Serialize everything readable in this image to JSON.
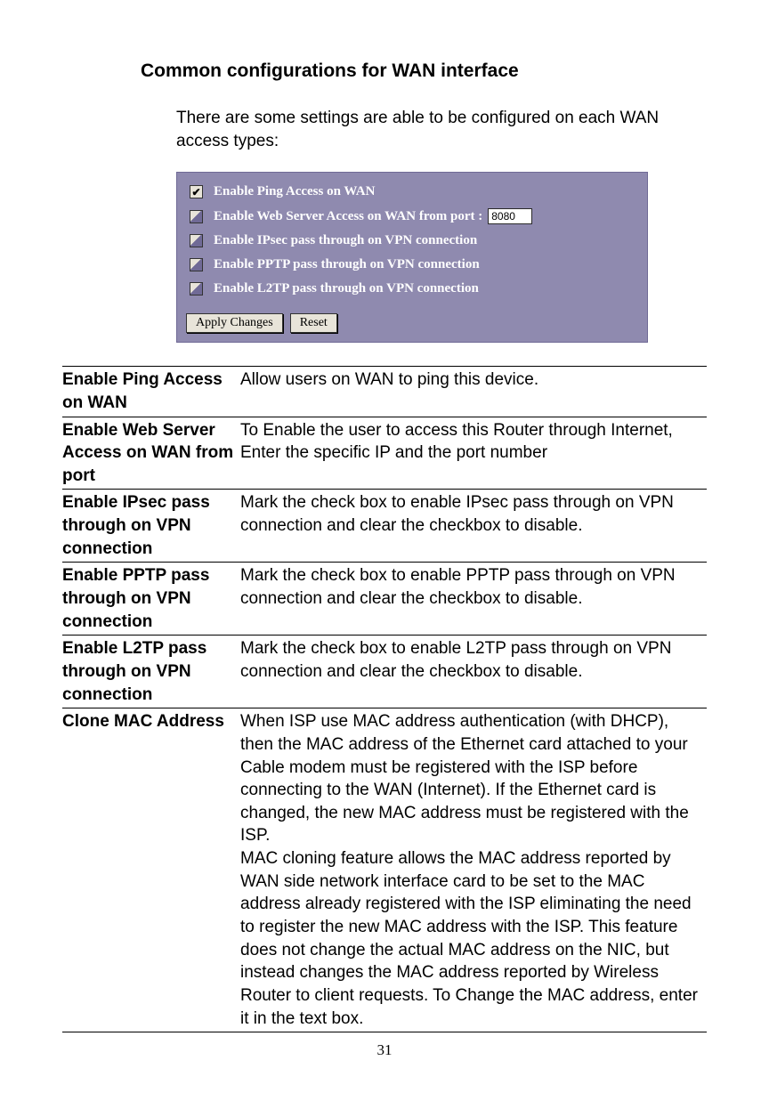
{
  "heading": "Common configurations for WAN interface",
  "intro": "There are some settings are able to be configured on each WAN access types:",
  "panel": {
    "rows": [
      {
        "label": "Enable Ping Access on WAN",
        "checked": true,
        "filled": false
      },
      {
        "label": "Enable Web Server Access on WAN from port :",
        "checked": false,
        "filled": true,
        "port": "8080"
      },
      {
        "label": "Enable IPsec pass through on VPN connection",
        "checked": false,
        "filled": true
      },
      {
        "label": "Enable PPTP pass through on VPN connection",
        "checked": false,
        "filled": true
      },
      {
        "label": "Enable L2TP pass through on VPN connection",
        "checked": false,
        "filled": true
      }
    ],
    "apply_label": "Apply Changes",
    "reset_label": "Reset"
  },
  "definitions": [
    {
      "term": "Enable Ping Access on WAN",
      "desc": "Allow users on WAN to ping this device."
    },
    {
      "term": "Enable Web Server Access on WAN from port",
      "desc": "To Enable the user to access this Router through Internet, Enter the specific IP and the port number"
    },
    {
      "term": "Enable IPsec pass through on VPN connection",
      "desc": "Mark the check box to enable IPsec pass through on VPN connection and clear the checkbox to disable."
    },
    {
      "term": "Enable PPTP pass through on VPN connection",
      "desc": "Mark the check box to enable PPTP pass through on VPN connection and clear the checkbox to disable."
    },
    {
      "term": "Enable L2TP pass through on VPN connection",
      "desc": "Mark the check box to enable L2TP pass through on VPN connection and clear the checkbox to disable."
    },
    {
      "term": "Clone MAC Address",
      "desc": "When ISP use MAC address authentication (with DHCP), then the MAC address of the Ethernet card attached to your Cable modem must be registered with the ISP before connecting to the WAN (Internet). If the Ethernet card is changed, the new MAC address must be registered with the ISP.\nMAC cloning feature allows the MAC address reported by WAN side network interface card to be set to the MAC address already registered with the ISP eliminating the need to register the new MAC address with the ISP. This feature does not change the actual MAC address on the NIC, but instead changes the MAC address reported by Wireless Router to client requests. To Change the MAC address, enter it in the text box."
    }
  ],
  "page_number": "31"
}
